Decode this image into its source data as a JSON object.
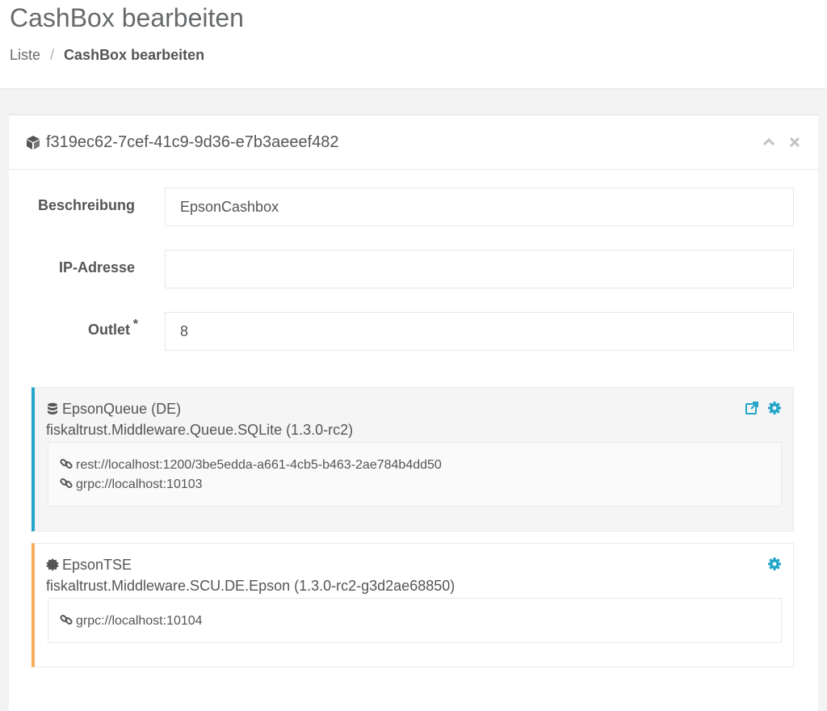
{
  "header": {
    "title": "CashBox bearbeiten",
    "breadcrumb": {
      "list_label": "Liste",
      "separator": "/",
      "current": "CashBox bearbeiten"
    }
  },
  "ibox": {
    "title": "f319ec62-7cef-41c9-9d36-e7b3aeeef482",
    "title_icon": "cube-icon",
    "tools": [
      "chevron-up-icon",
      "close-icon"
    ]
  },
  "form": {
    "description": {
      "label": "Beschreibung",
      "value": "EpsonCashbox"
    },
    "ip_address": {
      "label": "IP-Adresse",
      "value": ""
    },
    "outlet": {
      "label": "Outlet",
      "required_marker": "*",
      "value": "8"
    }
  },
  "packages": [
    {
      "type": "queue",
      "icon": "database-icon",
      "name": "EpsonQueue (DE)",
      "package": "fiskaltrust.Middleware.Queue.SQLite (1.3.0-rc2)",
      "accent": "#23a6c7",
      "actions": [
        "external-link-icon",
        "gear-icon"
      ],
      "urls": [
        "rest://localhost:1200/3be5edda-a661-4cb5-b463-2ae784b4dd50",
        "grpc://localhost:10103"
      ]
    },
    {
      "type": "scu",
      "icon": "certificate-icon",
      "name": "EpsonTSE",
      "package": "fiskaltrust.Middleware.SCU.DE.Epson (1.3.0-rc2-g3d2ae68850)",
      "accent": "#f8ac59",
      "actions": [
        "gear-icon"
      ],
      "urls": [
        "grpc://localhost:10104"
      ]
    }
  ],
  "colors": {
    "accent_blue": "#23a6c7",
    "accent_orange": "#f8ac59",
    "text": "#676a6c"
  }
}
